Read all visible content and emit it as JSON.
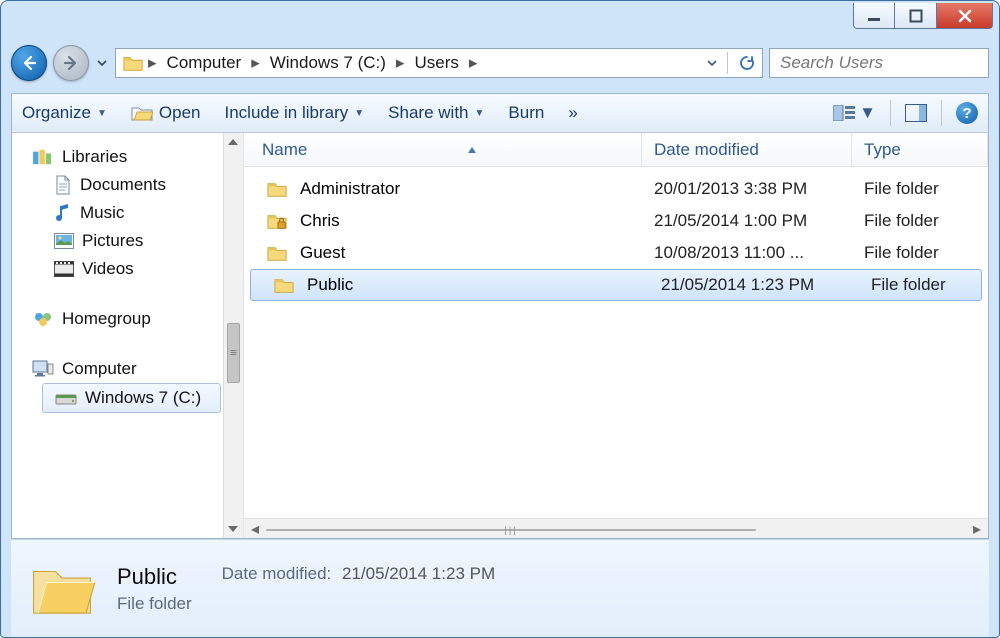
{
  "breadcrumbs": [
    "Computer",
    "Windows 7 (C:)",
    "Users"
  ],
  "search": {
    "placeholder": "Search Users"
  },
  "toolbar": {
    "organize": "Organize",
    "open": "Open",
    "include": "Include in library",
    "share": "Share with",
    "burn": "Burn"
  },
  "sidebar": {
    "libraries": "Libraries",
    "documents": "Documents",
    "music": "Music",
    "pictures": "Pictures",
    "videos": "Videos",
    "homegroup": "Homegroup",
    "computer": "Computer",
    "drive": "Windows 7 (C:)"
  },
  "columns": {
    "name": "Name",
    "date": "Date modified",
    "type": "Type"
  },
  "rows": [
    {
      "name": "Administrator",
      "date": "20/01/2013 3:38 PM",
      "type": "File folder",
      "locked": false,
      "selected": false
    },
    {
      "name": "Chris",
      "date": "21/05/2014 1:00 PM",
      "type": "File folder",
      "locked": true,
      "selected": false
    },
    {
      "name": "Guest",
      "date": "10/08/2013 11:00 ...",
      "type": "File folder",
      "locked": false,
      "selected": false
    },
    {
      "name": "Public",
      "date": "21/05/2014 1:23 PM",
      "type": "File folder",
      "locked": false,
      "selected": true
    }
  ],
  "details": {
    "name": "Public",
    "kind": "File folder",
    "date_label": "Date modified:",
    "date": "21/05/2014 1:23 PM"
  }
}
